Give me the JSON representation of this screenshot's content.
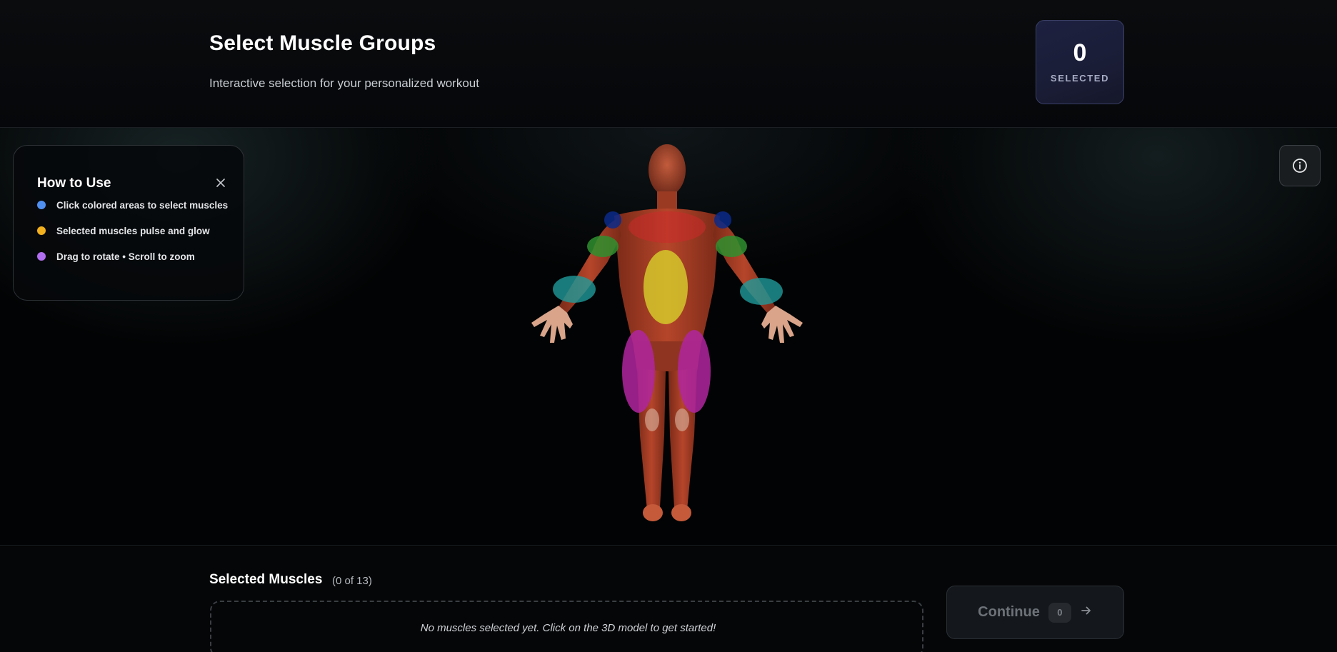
{
  "header": {
    "title": "Select Muscle Groups",
    "subtitle": "Interactive selection for your personalized workout",
    "selected_count": "0",
    "selected_label": "SELECTED"
  },
  "howto": {
    "title": "How to Use",
    "items": [
      {
        "text": "Click colored areas to select muscles",
        "color": "#4f8ff0"
      },
      {
        "text": "Selected muscles pulse and glow",
        "color": "#f2b01e"
      },
      {
        "text": "Drag to rotate • Scroll to zoom",
        "color": "#b16ef0"
      }
    ]
  },
  "icons": {
    "close": "close-icon",
    "info": "info-icon",
    "arrow": "arrow-right-icon"
  },
  "bottom": {
    "title": "Selected Muscles",
    "count_text": "(0 of 13)",
    "empty_text": "No muscles selected yet. Click on the 3D model to get started!",
    "continue_label": "Continue",
    "continue_count": "0"
  },
  "colors": {
    "accent_card": "#1d2140",
    "shoulders": "#0b2a8a",
    "biceps": "#2f8f2f",
    "forearms": "#1f9a9a",
    "abs": "#d7d12a",
    "quads": "#b0269f",
    "chest": "#cc2a2a"
  }
}
